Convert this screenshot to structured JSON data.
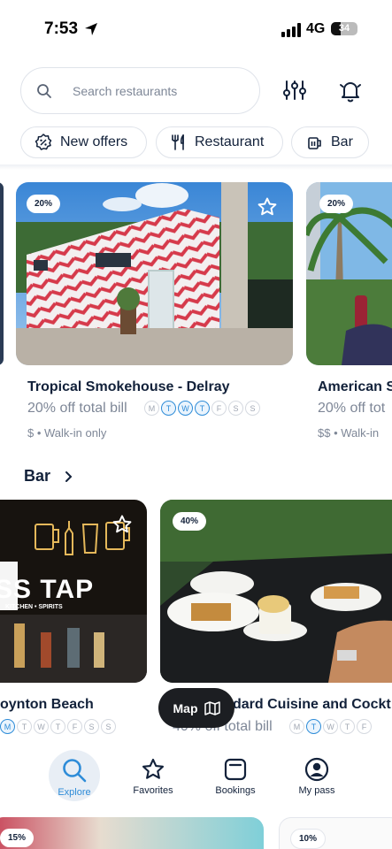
{
  "status_bar": {
    "time": "7:53",
    "network": "4G",
    "battery": "34"
  },
  "search": {
    "placeholder": "Search restaurants",
    "value": ""
  },
  "chips": [
    {
      "label": "New offers",
      "icon": "discount-icon"
    },
    {
      "label": "Restaurant",
      "icon": "fork-knife-icon"
    },
    {
      "label": "Bar",
      "icon": "beer-mug-icon"
    }
  ],
  "featured": [
    {
      "badge": "20%",
      "title": "Tropical Smokehouse - Delray",
      "offer": "20% off total bill",
      "price": "$",
      "mode": "Walk-in only",
      "days": [
        "M",
        "T",
        "W",
        "T",
        "F",
        "S",
        "S"
      ],
      "active_days": [
        false,
        true,
        true,
        true,
        false,
        false,
        false
      ]
    },
    {
      "badge": "20%",
      "title": "American S",
      "offer": "20% off tot",
      "price": "$$",
      "mode": "Walk-in"
    }
  ],
  "bar_section": {
    "title": "Bar",
    "cards": [
      {
        "title": "oynton Beach",
        "logo_text": "SS TAP",
        "logo_sub": "KITCHEN • SPIRITS",
        "days": [
          "M",
          "T",
          "W",
          "T",
          "F",
          "S",
          "S"
        ],
        "active_days": [
          true,
          false,
          false,
          false,
          false,
          false,
          false
        ]
      },
      {
        "badge": "40%",
        "title": "dard Cuisine and Cockt",
        "offer": "40% off total bill",
        "days": [
          "M",
          "T",
          "W",
          "T",
          "F"
        ],
        "active_days": [
          false,
          true,
          false,
          false,
          false
        ]
      }
    ]
  },
  "map_button": {
    "label": "Map"
  },
  "nav": [
    {
      "label": "Explore",
      "icon": "search-icon",
      "active": true
    },
    {
      "label": "Favorites",
      "icon": "star-icon"
    },
    {
      "label": "Bookings",
      "icon": "bookings-icon"
    },
    {
      "label": "My pass",
      "icon": "account-icon"
    }
  ],
  "bottom_peek": {
    "badges": [
      "15%",
      "10%"
    ]
  },
  "colors": {
    "accent": "#2e8cd8",
    "text": "#12213a",
    "muted": "#7e8797",
    "map_button": "#1c1e22"
  }
}
